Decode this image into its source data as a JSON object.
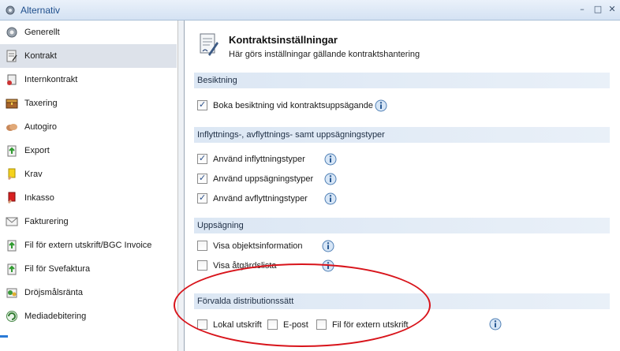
{
  "window": {
    "title": "Alternativ",
    "icon": "gear-icon",
    "controls": [
      "–",
      "□",
      "✕"
    ]
  },
  "sidebar": {
    "items": [
      {
        "label": "Generellt",
        "icon": "gear-icon",
        "selected": false
      },
      {
        "label": "Kontrakt",
        "icon": "contract-icon",
        "selected": true
      },
      {
        "label": "Internkontrakt",
        "icon": "internal-contract-icon",
        "selected": false
      },
      {
        "label": "Taxering",
        "icon": "treasure-chest-icon",
        "selected": false
      },
      {
        "label": "Autogiro",
        "icon": "handshake-icon",
        "selected": false
      },
      {
        "label": "Export",
        "icon": "export-icon",
        "selected": false
      },
      {
        "label": "Krav",
        "icon": "yellow-card-icon",
        "selected": false
      },
      {
        "label": "Inkasso",
        "icon": "red-card-icon",
        "selected": false
      },
      {
        "label": "Fakturering",
        "icon": "envelope-icon",
        "selected": false
      },
      {
        "label": "Fil för extern utskrift/BGC Invoice",
        "icon": "file-export-icon",
        "selected": false
      },
      {
        "label": "Fil för Svefaktura",
        "icon": "file-export-icon",
        "selected": false
      },
      {
        "label": "Dröjsmålsränta",
        "icon": "interest-icon",
        "selected": false
      },
      {
        "label": "Mediadebitering",
        "icon": "media-icon",
        "selected": false
      }
    ]
  },
  "header": {
    "title": "Kontraktsinställningar",
    "subtitle": "Här görs inställningar gällande kontraktshantering",
    "icon": "contract-document-icon"
  },
  "sections": {
    "besiktning": {
      "title": "Besiktning",
      "options": [
        {
          "label": "Boka besiktning vid kontraktsuppsägande",
          "checked": true
        }
      ]
    },
    "typer": {
      "title": "Inflyttnings-, avflyttnings- samt uppsägningstyper",
      "options": [
        {
          "label": "Använd inflyttningstyper",
          "checked": true
        },
        {
          "label": "Använd uppsägningstyper",
          "checked": true
        },
        {
          "label": "Använd avflyttningstyper",
          "checked": true
        }
      ]
    },
    "uppsagning": {
      "title": "Uppsägning",
      "options": [
        {
          "label": "Visa objektsinformation",
          "checked": false
        },
        {
          "label": "Visa åtgärdslista",
          "checked": false
        }
      ]
    },
    "distribution": {
      "title": "Förvalda distributionssätt",
      "options": [
        {
          "label": "Lokal utskrift",
          "checked": false
        },
        {
          "label": "E-post",
          "checked": false
        },
        {
          "label": "Fil för extern utskrift",
          "checked": false
        }
      ]
    }
  },
  "colors": {
    "accent": "#1e4e8c",
    "section_bg": "#dce7f4",
    "annotation": "#d8141b",
    "selected": "#dde2ea"
  }
}
